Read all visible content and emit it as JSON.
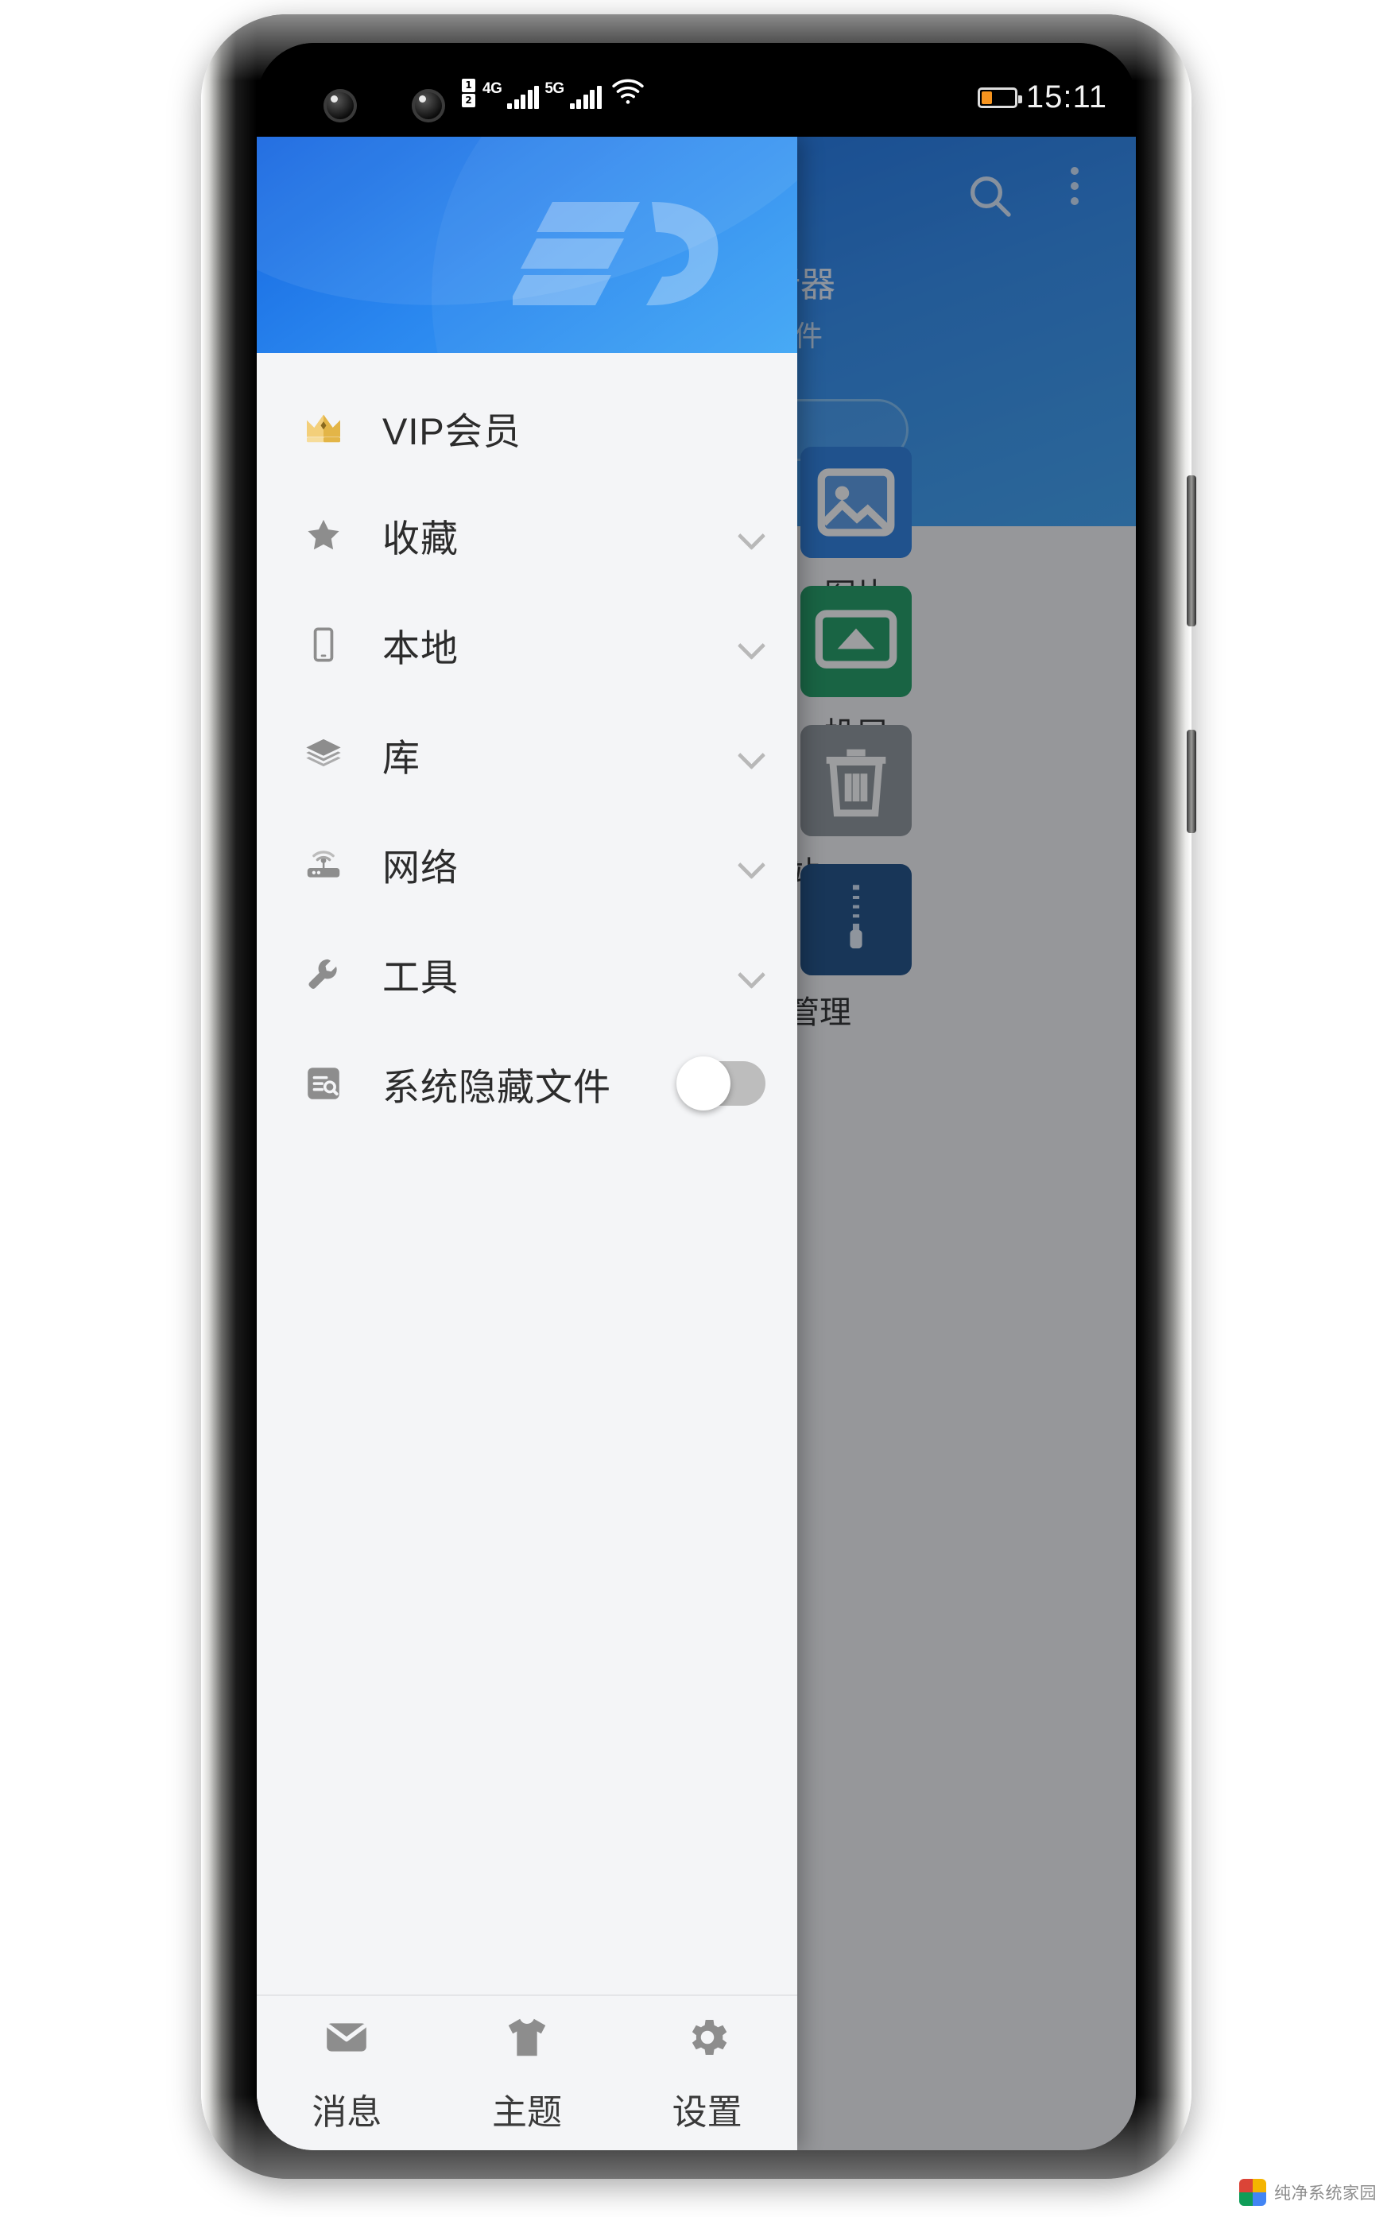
{
  "status_bar": {
    "sim1_badge": "1",
    "sim2_badge": "2",
    "network1": "4G",
    "network2": "5G",
    "wifi_icon": "wifi-icon",
    "battery_percent": 30,
    "battery_color": "#f7941e",
    "time": "15:11"
  },
  "background_app": {
    "search_icon": "search-icon",
    "overflow_icon": "overflow-menu-icon",
    "title_fragment": "新器",
    "subtitle_fragment": "文件",
    "tiles": [
      {
        "label": "图片",
        "icon": "image-icon",
        "color": "#2a7fe0"
      },
      {
        "label": "投屏",
        "icon": "cast-screen-icon",
        "color": "#1e9e63"
      },
      {
        "label": "回收站",
        "icon": "trash-icon",
        "color": "#8d9499"
      },
      {
        "label": "压缩管理",
        "icon": "zip-archive-icon",
        "color": "#1d4f86"
      }
    ]
  },
  "drawer": {
    "header": {
      "logo_text": "ES",
      "logo_name": "es-file-explorer-logo"
    },
    "items": [
      {
        "label": "VIP会员",
        "icon": "crown-icon",
        "has_chevron": false
      },
      {
        "label": "收藏",
        "icon": "star-icon",
        "has_chevron": true
      },
      {
        "label": "本地",
        "icon": "phone-icon",
        "has_chevron": true
      },
      {
        "label": "库",
        "icon": "layers-icon",
        "has_chevron": true
      },
      {
        "label": "网络",
        "icon": "router-icon",
        "has_chevron": true
      },
      {
        "label": "工具",
        "icon": "wrench-icon",
        "has_chevron": true
      }
    ],
    "toggle_row": {
      "label": "系统隐藏文件",
      "icon": "list-search-icon",
      "toggle_state": "off"
    },
    "bottom_nav": [
      {
        "label": "消息",
        "icon": "envelope-icon"
      },
      {
        "label": "主题",
        "icon": "tshirt-icon"
      },
      {
        "label": "设置",
        "icon": "gear-icon"
      }
    ]
  },
  "watermark": {
    "text": "纯净系统家园",
    "icon": "colored-square-icon"
  },
  "colors": {
    "drawer_header_blue": "#2a87ef",
    "app_toolbar_blue": "#2f8cf0",
    "drawer_bg": "#f4f5f7",
    "icon_gray": "#8d8d8d",
    "crown_gold": "#f0c659"
  }
}
